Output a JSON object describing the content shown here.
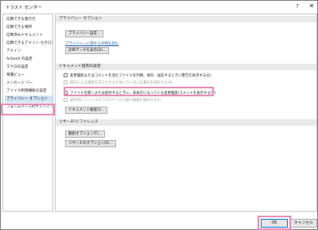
{
  "window": {
    "title": "トラスト センター",
    "help_icon": "?",
    "close_icon": "✕"
  },
  "sidebar": {
    "items": [
      {
        "label": "信頼できる発行元"
      },
      {
        "label": "信頼できる場所"
      },
      {
        "label": "信頼済みドキュメント"
      },
      {
        "label": "信頼できるアドイン カタログ"
      },
      {
        "label": "アドイン"
      },
      {
        "label": "ActiveX の設定"
      },
      {
        "label": "マクロの設定"
      },
      {
        "label": "保護ビュー"
      },
      {
        "label": "メッセージ バー"
      },
      {
        "label": "ファイル制限機能の設定"
      },
      {
        "label": "プライバシー オプション"
      },
      {
        "label": "フォームベースのサインイン"
      }
    ],
    "selected_index": 10
  },
  "privacy": {
    "heading": "プライバシー オプション",
    "settings_button": "プライバシー設定...",
    "link": "プライバシーに関する声明を読む",
    "diagnostics_button": "診断データを表示(D)..."
  },
  "doc_settings": {
    "heading": "ドキュメント固有の設定",
    "checkboxes": [
      {
        "label": "変更履歴またはコメントを含むファイルを印刷、保存、送信するときに警告を表示する(E)",
        "checked": false,
        "disabled": false
      },
      {
        "label": "保存による精度を向上させるためにランダムな番号を保存する(R)",
        "checked": false,
        "disabled": true
      },
      {
        "label": "ファイルを開くまたは保持するときに、非表示になっている変更履歴/コメントを表示する(V)",
        "checked": false,
        "disabled": false
      },
      {
        "label": "保存時にファイルのプロパティから個人情報を削除する(I)",
        "checked": false,
        "disabled": true
      }
    ],
    "inspector_button": "ドキュメント検査(I)..."
  },
  "research": {
    "heading": "リサーチ/リファレンス",
    "translation_button": "翻訳オプション(T)...",
    "research_button": "リサーチのオプション(R)..."
  },
  "footer": {
    "ok_label": "OK",
    "cancel_label": "キャンセル"
  },
  "colors": {
    "highlight": "#e98bb7",
    "selected": "#cfe4f7",
    "link": "#1f5fb0"
  }
}
